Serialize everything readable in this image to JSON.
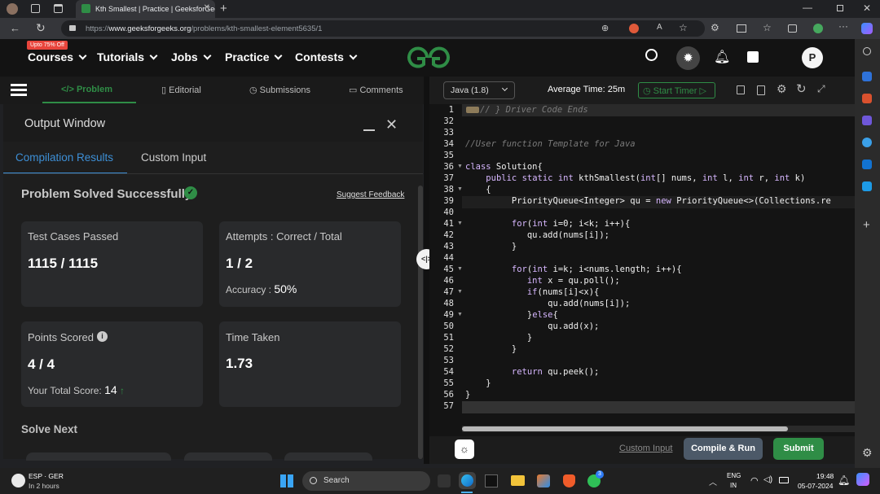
{
  "browser": {
    "tab_title": "Kth Smallest | Practice | GeeksforGeeks",
    "url_prefix": "https://",
    "url_domain": "www.geeksforgeeks.org",
    "url_path": "/problems/kth-smallest-element5635/1"
  },
  "header": {
    "promo_badge": "Upto 75% Off",
    "nav": [
      "Courses",
      "Tutorials",
      "Jobs",
      "Practice",
      "Contests"
    ],
    "avatar_letter": "P",
    "logo_color": "#2f8d46"
  },
  "problem_tabs": [
    "Problem",
    "Editorial",
    "Submissions",
    "Comments"
  ],
  "output": {
    "title": "Output Window",
    "tabs": [
      "Compilation Results",
      "Custom Input"
    ],
    "status": "Problem Solved Successfully",
    "feedback": "Suggest Feedback",
    "test_cases_label": "Test Cases Passed",
    "test_cases_value": "1115 / 1115",
    "attempts_label": "Attempts : Correct / Total",
    "attempts_value": "1 / 2",
    "accuracy_label": "Accuracy :",
    "accuracy_value": "50%",
    "points_label": "Points Scored",
    "points_value": "4 / 4",
    "total_score_label": "Your Total Score:",
    "total_score_value": "14",
    "time_label": "Time Taken",
    "time_value": "1.73",
    "solve_next": "Solve Next"
  },
  "editor": {
    "language": "Java (1.8)",
    "avg_time_label": "Average Time: 25m",
    "start_timer": "Start Timer",
    "lines": [
      {
        "n": "1",
        "code": "// } Driver Code Ends"
      },
      {
        "n": "32",
        "code": ""
      },
      {
        "n": "33",
        "code": ""
      },
      {
        "n": "34",
        "code": "//User function Template for Java"
      },
      {
        "n": "35",
        "code": ""
      },
      {
        "n": "36",
        "code": "class Solution{"
      },
      {
        "n": "37",
        "code": "    public static int kthSmallest(int[] nums, int l, int r, int k)"
      },
      {
        "n": "38",
        "code": "    {"
      },
      {
        "n": "39",
        "code": "         PriorityQueue<Integer> qu = new PriorityQueue<>(Collections.re"
      },
      {
        "n": "40",
        "code": ""
      },
      {
        "n": "41",
        "code": "         for(int i=0; i<k; i++){"
      },
      {
        "n": "42",
        "code": "            qu.add(nums[i]);"
      },
      {
        "n": "43",
        "code": "         }"
      },
      {
        "n": "44",
        "code": ""
      },
      {
        "n": "45",
        "code": "         for(int i=k; i<nums.length; i++){"
      },
      {
        "n": "46",
        "code": "            int x = qu.poll();"
      },
      {
        "n": "47",
        "code": "            if(nums[i]<x){"
      },
      {
        "n": "48",
        "code": "                qu.add(nums[i]);"
      },
      {
        "n": "49",
        "code": "            }else{"
      },
      {
        "n": "50",
        "code": "                qu.add(x);"
      },
      {
        "n": "51",
        "code": "            }"
      },
      {
        "n": "52",
        "code": "         }"
      },
      {
        "n": "53",
        "code": ""
      },
      {
        "n": "54",
        "code": "         return qu.peek();"
      },
      {
        "n": "55",
        "code": "    }"
      },
      {
        "n": "56",
        "code": "}"
      },
      {
        "n": "57",
        "code": ""
      }
    ],
    "custom_input": "Custom Input",
    "compile_run": "Compile & Run",
    "submit": "Submit"
  },
  "taskbar": {
    "weather_title": "ESP · GER",
    "weather_sub": "In 2 hours",
    "search": "Search",
    "lang_top": "ENG",
    "lang_bottom": "IN",
    "time": "19:48",
    "date": "05-07-2024",
    "badge_count": "3"
  }
}
